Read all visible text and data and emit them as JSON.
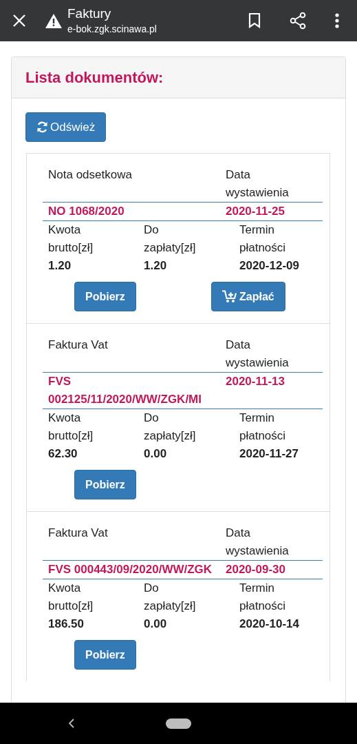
{
  "browser_bar": {
    "title": "Faktury",
    "url": "e-bok.zgk.scinawa.pl"
  },
  "panel": {
    "title": "Lista dokumentów:",
    "refresh_button": "Odśwież",
    "documents": [
      {
        "type": "Nota odsetkowa",
        "date_label": "Data wystawienia",
        "number": "NO 1068/2020",
        "date": "2020-11-25",
        "fields": [
          {
            "label": "Kwota brutto[zł]",
            "value": "1.20"
          },
          {
            "label": "Do zapłaty[zł]",
            "value": "1.20"
          },
          {
            "label": "Termin płatności",
            "value": "2020-12-09"
          }
        ],
        "buttons": [
          {
            "kind": "download",
            "label": "Pobierz"
          },
          {
            "kind": "pay",
            "label": "Zapłać"
          }
        ]
      },
      {
        "type": "Faktura Vat",
        "date_label": "Data wystawienia",
        "number": "FVS 002125/11/2020/WW/ZGK/MI",
        "date": "2020-11-13",
        "fields": [
          {
            "label": "Kwota brutto[zł]",
            "value": "62.30"
          },
          {
            "label": "Do zapłaty[zł]",
            "value": "0.00"
          },
          {
            "label": "Termin płatności",
            "value": "2020-11-27"
          }
        ],
        "buttons": [
          {
            "kind": "download",
            "label": "Pobierz"
          }
        ]
      },
      {
        "type": "Faktura Vat",
        "date_label": "Data wystawienia",
        "number": "FVS 000443/09/2020/WW/ZGK",
        "date": "2020-09-30",
        "fields": [
          {
            "label": "Kwota brutto[zł]",
            "value": "186.50"
          },
          {
            "label": "Do zapłaty[zł]",
            "value": "0.00"
          },
          {
            "label": "Termin płatności",
            "value": "2020-10-14"
          }
        ],
        "buttons": [
          {
            "kind": "download",
            "label": "Pobierz"
          }
        ]
      }
    ]
  }
}
